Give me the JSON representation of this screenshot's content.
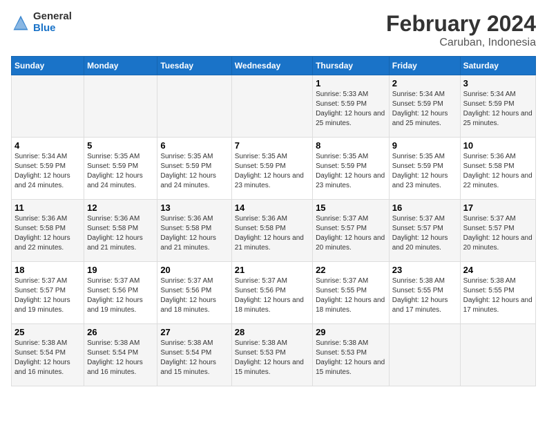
{
  "header": {
    "logo_general": "General",
    "logo_blue": "Blue",
    "main_title": "February 2024",
    "sub_title": "Caruban, Indonesia"
  },
  "columns": [
    "Sunday",
    "Monday",
    "Tuesday",
    "Wednesday",
    "Thursday",
    "Friday",
    "Saturday"
  ],
  "weeks": [
    [
      {
        "day": "",
        "info": ""
      },
      {
        "day": "",
        "info": ""
      },
      {
        "day": "",
        "info": ""
      },
      {
        "day": "",
        "info": ""
      },
      {
        "day": "1",
        "info": "Sunrise: 5:33 AM\nSunset: 5:59 PM\nDaylight: 12 hours and 25 minutes."
      },
      {
        "day": "2",
        "info": "Sunrise: 5:34 AM\nSunset: 5:59 PM\nDaylight: 12 hours and 25 minutes."
      },
      {
        "day": "3",
        "info": "Sunrise: 5:34 AM\nSunset: 5:59 PM\nDaylight: 12 hours and 25 minutes."
      }
    ],
    [
      {
        "day": "4",
        "info": "Sunrise: 5:34 AM\nSunset: 5:59 PM\nDaylight: 12 hours and 24 minutes."
      },
      {
        "day": "5",
        "info": "Sunrise: 5:35 AM\nSunset: 5:59 PM\nDaylight: 12 hours and 24 minutes."
      },
      {
        "day": "6",
        "info": "Sunrise: 5:35 AM\nSunset: 5:59 PM\nDaylight: 12 hours and 24 minutes."
      },
      {
        "day": "7",
        "info": "Sunrise: 5:35 AM\nSunset: 5:59 PM\nDaylight: 12 hours and 23 minutes."
      },
      {
        "day": "8",
        "info": "Sunrise: 5:35 AM\nSunset: 5:59 PM\nDaylight: 12 hours and 23 minutes."
      },
      {
        "day": "9",
        "info": "Sunrise: 5:35 AM\nSunset: 5:59 PM\nDaylight: 12 hours and 23 minutes."
      },
      {
        "day": "10",
        "info": "Sunrise: 5:36 AM\nSunset: 5:58 PM\nDaylight: 12 hours and 22 minutes."
      }
    ],
    [
      {
        "day": "11",
        "info": "Sunrise: 5:36 AM\nSunset: 5:58 PM\nDaylight: 12 hours and 22 minutes."
      },
      {
        "day": "12",
        "info": "Sunrise: 5:36 AM\nSunset: 5:58 PM\nDaylight: 12 hours and 21 minutes."
      },
      {
        "day": "13",
        "info": "Sunrise: 5:36 AM\nSunset: 5:58 PM\nDaylight: 12 hours and 21 minutes."
      },
      {
        "day": "14",
        "info": "Sunrise: 5:36 AM\nSunset: 5:58 PM\nDaylight: 12 hours and 21 minutes."
      },
      {
        "day": "15",
        "info": "Sunrise: 5:37 AM\nSunset: 5:57 PM\nDaylight: 12 hours and 20 minutes."
      },
      {
        "day": "16",
        "info": "Sunrise: 5:37 AM\nSunset: 5:57 PM\nDaylight: 12 hours and 20 minutes."
      },
      {
        "day": "17",
        "info": "Sunrise: 5:37 AM\nSunset: 5:57 PM\nDaylight: 12 hours and 20 minutes."
      }
    ],
    [
      {
        "day": "18",
        "info": "Sunrise: 5:37 AM\nSunset: 5:57 PM\nDaylight: 12 hours and 19 minutes."
      },
      {
        "day": "19",
        "info": "Sunrise: 5:37 AM\nSunset: 5:56 PM\nDaylight: 12 hours and 19 minutes."
      },
      {
        "day": "20",
        "info": "Sunrise: 5:37 AM\nSunset: 5:56 PM\nDaylight: 12 hours and 18 minutes."
      },
      {
        "day": "21",
        "info": "Sunrise: 5:37 AM\nSunset: 5:56 PM\nDaylight: 12 hours and 18 minutes."
      },
      {
        "day": "22",
        "info": "Sunrise: 5:37 AM\nSunset: 5:55 PM\nDaylight: 12 hours and 18 minutes."
      },
      {
        "day": "23",
        "info": "Sunrise: 5:38 AM\nSunset: 5:55 PM\nDaylight: 12 hours and 17 minutes."
      },
      {
        "day": "24",
        "info": "Sunrise: 5:38 AM\nSunset: 5:55 PM\nDaylight: 12 hours and 17 minutes."
      }
    ],
    [
      {
        "day": "25",
        "info": "Sunrise: 5:38 AM\nSunset: 5:54 PM\nDaylight: 12 hours and 16 minutes."
      },
      {
        "day": "26",
        "info": "Sunrise: 5:38 AM\nSunset: 5:54 PM\nDaylight: 12 hours and 16 minutes."
      },
      {
        "day": "27",
        "info": "Sunrise: 5:38 AM\nSunset: 5:54 PM\nDaylight: 12 hours and 15 minutes."
      },
      {
        "day": "28",
        "info": "Sunrise: 5:38 AM\nSunset: 5:53 PM\nDaylight: 12 hours and 15 minutes."
      },
      {
        "day": "29",
        "info": "Sunrise: 5:38 AM\nSunset: 5:53 PM\nDaylight: 12 hours and 15 minutes."
      },
      {
        "day": "",
        "info": ""
      },
      {
        "day": "",
        "info": ""
      }
    ]
  ]
}
